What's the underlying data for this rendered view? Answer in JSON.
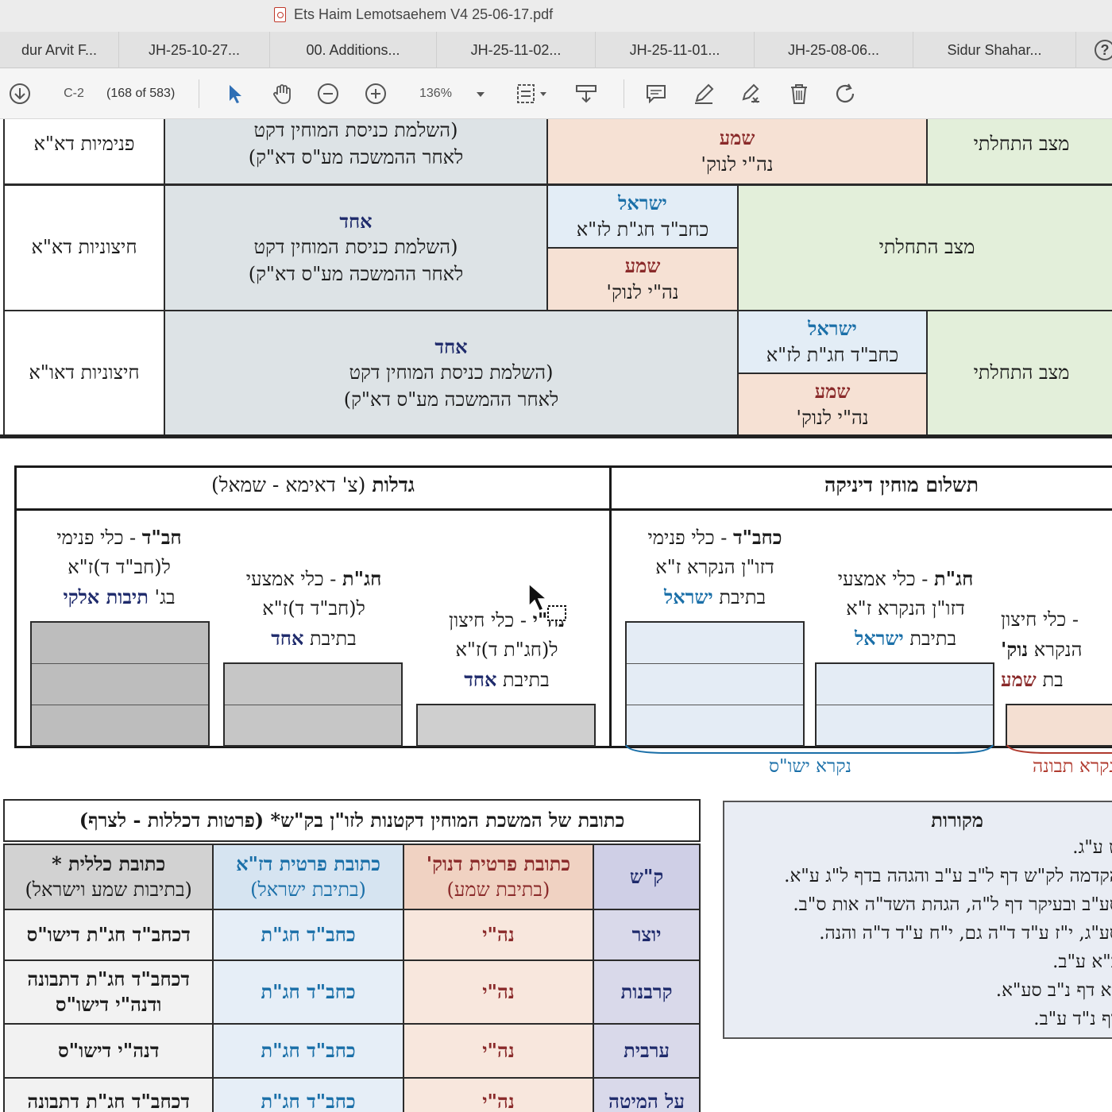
{
  "window": {
    "title": "Ets Haim Lemotsaehem V4 25-06-17.pdf"
  },
  "tabs": [
    {
      "label": "dur Arvit F..."
    },
    {
      "label": "JH-25-10-27..."
    },
    {
      "label": "00. Additions..."
    },
    {
      "label": "JH-25-11-02..."
    },
    {
      "label": "JH-25-11-01..."
    },
    {
      "label": "JH-25-08-06..."
    },
    {
      "label": "Sidur Shahar..."
    }
  ],
  "help": "?",
  "toolbar": {
    "page_label": "C-2",
    "page_count": "(168 of 583)",
    "zoom": "136%"
  },
  "icons": {
    "download": "download-icon",
    "select": "arrow-pointer-icon",
    "hand": "hand-icon",
    "zoom_out": "zoom-out-icon",
    "zoom_in": "zoom-in-icon",
    "fit": "fit-page-icon",
    "marker": "marker-icon",
    "comment": "comment-icon",
    "pen": "pen-icon",
    "sign": "sign-icon",
    "trash": "trash-icon",
    "undo": "rotate-icon"
  },
  "table1": {
    "row1": {
      "achad_lines": [
        "(השלמת כניסת המוחין דקט",
        "לאחר ההמשכה מע\"ס דא\"ק)"
      ],
      "shema_word": "שמע",
      "shema_sub": "נה\"י לנוק'",
      "state": "מצב התחלתי",
      "left_label": "פנימיות דא\"א"
    },
    "row2": {
      "left_label": "חיצוניות דא\"א",
      "achad_word": "אחד",
      "achad_lines": [
        "(השלמת כניסת המוחין דקט",
        "לאחר ההמשכה מע\"ס דא\"ק)"
      ],
      "israel_word": "ישראל",
      "israel_sub": "כחב\"ד חג\"ת לז\"א",
      "shema_word": "שמע",
      "shema_sub": "נה\"י לנוק'",
      "state": "מצב התחלתי"
    },
    "row3": {
      "left_label": "חיצוניות דאו\"א",
      "achad_word": "אחד",
      "achad_lines": [
        "(השלמת כניסת המוחין דקט",
        "לאחר ההמשכה מע\"ס דא\"ק)"
      ],
      "israel_word": "ישראל",
      "israel_sub": "כחב\"ד חג\"ת לז\"א",
      "shema_word": "שמע",
      "shema_sub": "נה\"י לנוק'",
      "state": "מצב התחלתי"
    }
  },
  "gadlut": {
    "title_bold": "גדלות",
    "title_rest": " (צ' דאימא - שמאל)",
    "col_a": {
      "bold": "חב\"ד",
      "rest": " - כלי פנימי",
      "l2": "ל(חב\"ד ד)ז\"א",
      "l3_pre": "בג' ",
      "l3_hl": "תיבות אלקי"
    },
    "col_b": {
      "bold": "חג\"ת",
      "rest": " - כלי אמצעי",
      "l2": "ל(חב\"ד ד)ז\"א",
      "l3_pre": "בתיבת ",
      "l3_hl": "אחד"
    },
    "col_c": {
      "bold": "נה\"י",
      "rest": " - כלי חיצון",
      "l2": "ל(חג\"ת ד)ז\"א",
      "l3_pre": "בתיבת ",
      "l3_hl": "אחד"
    }
  },
  "yenika": {
    "title": "תשלום מוחין דיניקה",
    "col_a": {
      "bold": "כחב\"ד",
      "rest": " - כלי פנימי",
      "l2": "דזו\"ן הנקרא ז\"א",
      "l3_pre": "בתיבת ",
      "l3_hl": "ישראל"
    },
    "col_b": {
      "bold": "חג\"ת",
      "rest": " - כלי אמצעי",
      "l2": "דזו\"ן הנקרא ז\"א",
      "l3_pre": "בתיבת ",
      "l3_hl": "ישראל"
    },
    "col_c": {
      "rest": "- כלי חיצון",
      "l2_pre": "הנקרא ",
      "l2_hl": "נוק'",
      "l3_pre": "בת ",
      "l3_hl": "שמע"
    },
    "bracket_blue": "נקרא ישו\"ס",
    "bracket_red": "נקרא תבונה"
  },
  "table2": {
    "header": "כתובת של המשכת המוחין דקטנות לזו\"ן בק\"ש* (פרטות דכללות - לצרף)",
    "cols": [
      {
        "l1": "ק\"ש",
        "l2": ""
      },
      {
        "l1": "כתובת פרטית דנוק'",
        "l2": "(בתיבת שמע)"
      },
      {
        "l1": "כתובת פרטית דז\"א",
        "l2": "(בתיבת ישראל)"
      },
      {
        "l1": "כתובת כללית *",
        "l2": "(בתיבות שמע וישראל)"
      }
    ],
    "rows": [
      {
        "name": "יוצר",
        "nuk": "נה\"י",
        "za": "כחב\"ד חג\"ת",
        "klali": "דכחב\"ד חג\"ת דישו\"ס"
      },
      {
        "name": "קרבנות",
        "nuk": "נה\"י",
        "za": "כחב\"ד חג\"ת",
        "klali": "דכחב\"ד חג\"ת דתבונה ודנה\"י דישו\"ס"
      },
      {
        "name": "ערבית",
        "nuk": "נה\"י",
        "za": "כחב\"ד חג\"ת",
        "klali": "דנה\"י דישו\"ס"
      },
      {
        "name": "על המיטה",
        "nuk": "נה\"י",
        "za": "כחב\"ד חג\"ת",
        "klali": "דכחב\"ד חג\"ת דתבונה"
      }
    ]
  },
  "sources": {
    "title": "מקורות",
    "lines": [
      "ט ע\"ג.",
      "הקדמה לק\"ש דף ל\"ב ע\"ב והגהה בדף ל\"ג ע\"א.",
      "סע\"ב ובעיקר דף ל\"ה, הגהת השד\"ה אות ס\"ב.",
      "סע\"ג, י\"ז ע\"ד ד\"ה גם, י\"ח ע\"ד ד\"ה והנה.",
      "כ\"א ע\"ב.",
      "\"א דף נ\"ב סע\"א.",
      "דף נ\"ד ע\"ב."
    ]
  }
}
